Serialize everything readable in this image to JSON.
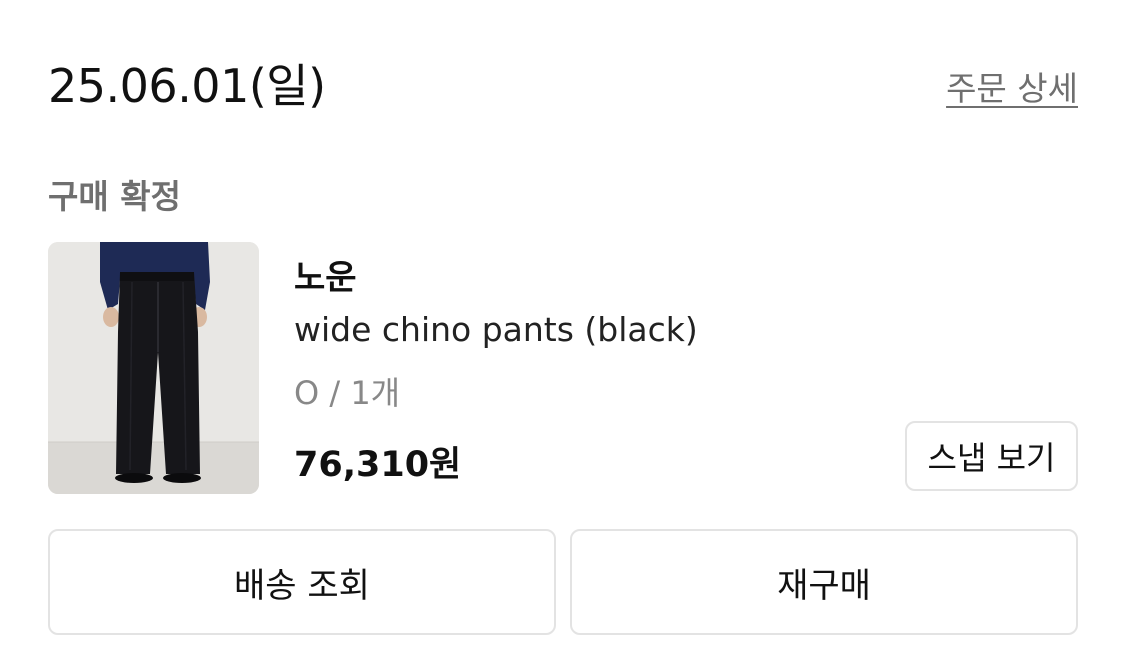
{
  "order": {
    "date": "25.06.01(일)",
    "detail_link": "주문 상세",
    "status": "구매 확정"
  },
  "product": {
    "image_icon": "product-photo",
    "brand": "노운",
    "name": "wide chino pants (black)",
    "option": "O / 1개",
    "price": "76,310원",
    "snap_button": "스냅 보기"
  },
  "actions": {
    "delivery": "배송 조회",
    "reorder": "재구매"
  }
}
